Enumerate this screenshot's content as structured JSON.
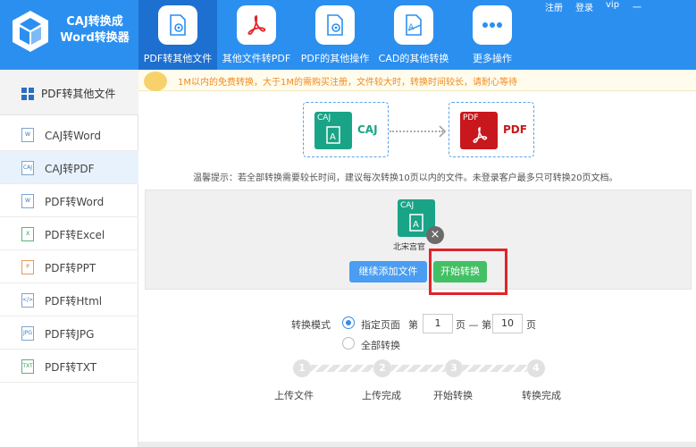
{
  "app": {
    "title_line1": "CAJ转换成",
    "title_line2": "Word转换器"
  },
  "top_links": [
    "注册",
    "登录",
    "vip",
    "一"
  ],
  "nav_tabs": [
    {
      "label": "PDF转其他文件",
      "icon": "pdf-gear-icon",
      "active": true
    },
    {
      "label": "其他文件转PDF",
      "icon": "pdf-acrobat-icon",
      "active": false
    },
    {
      "label": "PDF的其他操作",
      "icon": "pdf-gear-icon",
      "active": false
    },
    {
      "label": "CAD的其他转换",
      "icon": "cad-icon",
      "active": false
    },
    {
      "label": "更多操作",
      "icon": "more-dots-icon",
      "active": false
    }
  ],
  "sidebar": {
    "header": "PDF转其他文件",
    "items": [
      {
        "label": "CAJ转Word",
        "icon": "W",
        "active": false
      },
      {
        "label": "CAJ转PDF",
        "icon": "CAJ",
        "active": true
      },
      {
        "label": "PDF转Word",
        "icon": "W",
        "active": false
      },
      {
        "label": "PDF转Excel",
        "icon": "X",
        "active": false
      },
      {
        "label": "PDF转PPT",
        "icon": "P",
        "active": false
      },
      {
        "label": "PDF转Html",
        "icon": "</>",
        "active": false
      },
      {
        "label": "PDF转JPG",
        "icon": "JPG",
        "active": false
      },
      {
        "label": "PDF转TXT",
        "icon": "TXT",
        "active": false
      }
    ]
  },
  "notice": "1M以内的免费转换，大于1M的需购买注册，文件较大时，转换时间较长，请耐心等待",
  "flow": {
    "from_tag": "CAJ",
    "from_label": "CAJ",
    "to_tag": "PDF",
    "to_label": "PDF"
  },
  "tip": "温馨提示：若全部转换需要较长时间，建议每次转换10页以内的文件。未登录客户最多只可转换20页文档。",
  "file": {
    "tag": "CAJ",
    "name": "北宋宫官"
  },
  "buttons": {
    "add": "继续添加文件",
    "start": "开始转换"
  },
  "options": {
    "mode_label": "转换模式",
    "specified_label": "指定页面",
    "page_prefix": "第",
    "page_from": "1",
    "page_mid": "页 — 第",
    "page_to": "10",
    "page_suffix": "页",
    "all_label": "全部转换",
    "selected": "specified"
  },
  "steps": [
    {
      "num": "1",
      "label": "上传文件"
    },
    {
      "num": "2",
      "label": "上传完成"
    },
    {
      "num": "3",
      "label": "开始转换"
    },
    {
      "num": "4",
      "label": "转换完成"
    }
  ],
  "colors": {
    "header": "#2b8ff0",
    "active_tab": "#1d6fd0",
    "caj_green": "#1aa487",
    "pdf_red": "#c8181d",
    "start_green": "#43c065",
    "highlight_red": "#e0242a"
  }
}
